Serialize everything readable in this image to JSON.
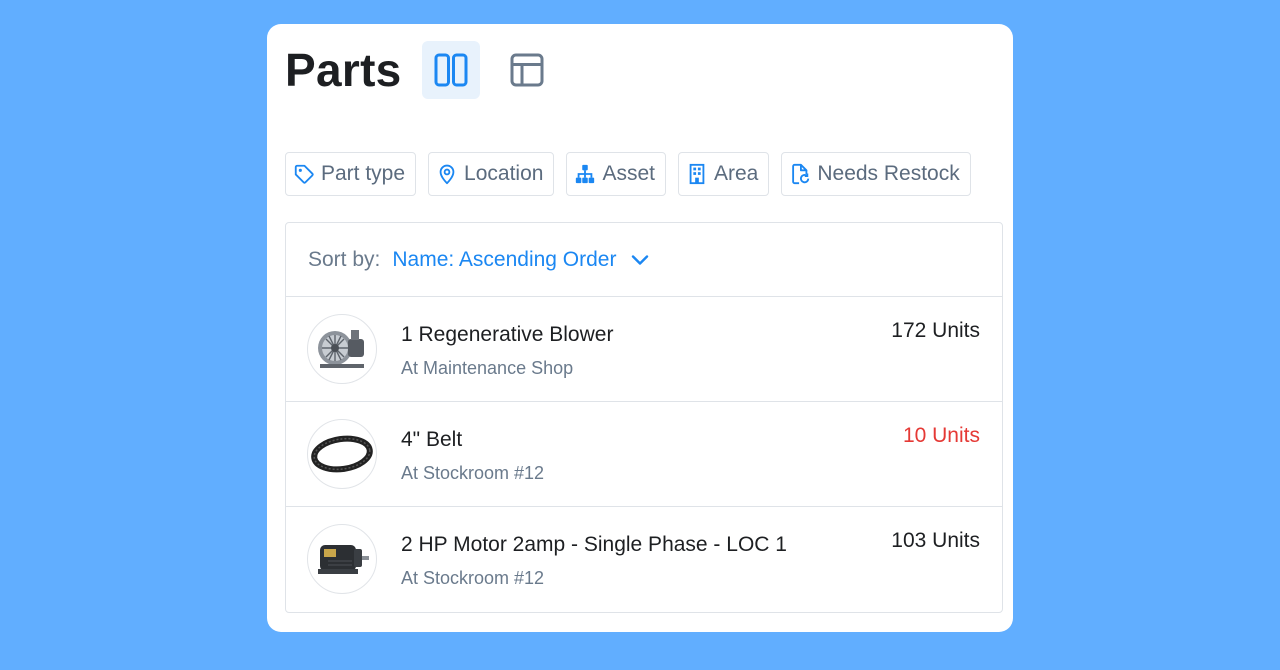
{
  "header": {
    "title": "Parts",
    "views": [
      {
        "name": "split-view",
        "active": true
      },
      {
        "name": "table-view",
        "active": false
      }
    ]
  },
  "filters": [
    {
      "label": "Part type",
      "icon": "tag-icon"
    },
    {
      "label": "Location",
      "icon": "location-pin-icon"
    },
    {
      "label": "Asset",
      "icon": "hierarchy-icon"
    },
    {
      "label": "Area",
      "icon": "building-icon"
    },
    {
      "label": "Needs Restock",
      "icon": "restock-document-icon"
    }
  ],
  "sort": {
    "label": "Sort by:",
    "value": "Name: Ascending Order"
  },
  "parts": [
    {
      "name": "1 Regenerative Blower",
      "location": "At Maintenance Shop",
      "quantity": "172 Units",
      "low_stock": false,
      "image": "blower-image"
    },
    {
      "name": "4\" Belt",
      "location": "At Stockroom #12",
      "quantity": "10 Units",
      "low_stock": true,
      "image": "belt-image"
    },
    {
      "name": "2 HP Motor 2amp - Single Phase - LOC 1",
      "location": "At Stockroom #12",
      "quantity": "103 Units",
      "low_stock": false,
      "image": "motor-image"
    }
  ],
  "colors": {
    "background": "#61aeff",
    "accent": "#1b87f2",
    "low_stock": "#e53935",
    "muted_text": "#6a7a8c"
  }
}
